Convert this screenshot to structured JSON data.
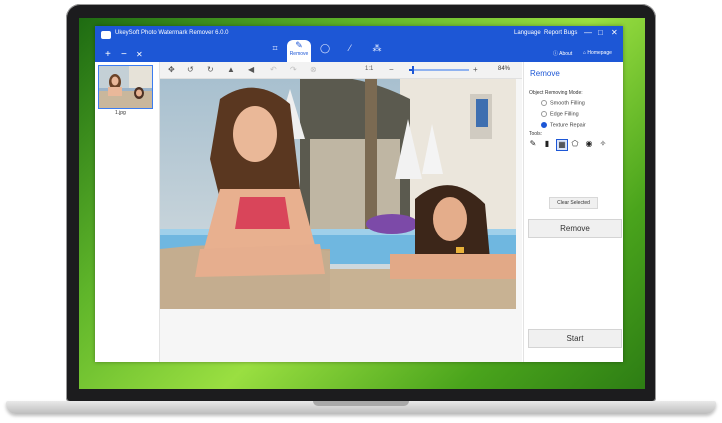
{
  "window": {
    "title": "UkeySoft Photo Watermark Remover 6.0.0",
    "language": "Language",
    "report_bugs": "Report Bugs",
    "about": "About",
    "homepage": "Homepage",
    "minimize": "—",
    "maximize": "□",
    "close": "✕"
  },
  "file_controls": {
    "add": "+",
    "remove": "−",
    "clear": "✕"
  },
  "toolbar": {
    "tabs": [
      {
        "icon": "crop-icon",
        "glyph": "⌗",
        "label": ""
      },
      {
        "icon": "eraser-icon",
        "glyph": "✎",
        "label": "Remove"
      },
      {
        "icon": "drop-icon",
        "glyph": "◯",
        "label": ""
      },
      {
        "icon": "brush-icon",
        "glyph": "⁄",
        "label": ""
      },
      {
        "icon": "key-icon",
        "glyph": "⁂",
        "label": ""
      }
    ]
  },
  "thumbnails": [
    {
      "filename": "1.jpg"
    }
  ],
  "canvas_toolbar": {
    "icons": [
      "move-icon",
      "rotate-left-icon",
      "rotate-right-icon",
      "flip-icon",
      "flip-vertical-icon",
      "undo-icon",
      "redo-icon",
      "reset-icon"
    ],
    "ratio": "1:1",
    "zoom_minus": "−",
    "zoom_plus": "+",
    "zoom_fraction": 0.05,
    "zoom_percent": "84%"
  },
  "right_panel": {
    "title": "Remove",
    "mode_label": "Object Removing Mode:",
    "modes": [
      {
        "label": "Smooth Filling",
        "selected": false
      },
      {
        "label": "Edge Filling",
        "selected": false
      },
      {
        "label": "Texture Repair",
        "selected": true
      }
    ],
    "tools_label": "Tools:",
    "tools": [
      "brush-icon",
      "eraser-icon",
      "rectangle-select-icon",
      "polygon-select-icon",
      "fill-bucket-icon",
      "magic-wand-icon"
    ],
    "clear_selected": "Clear Selected",
    "remove_button": "Remove",
    "start_button": "Start"
  },
  "colors": {
    "accent": "#1d57d6",
    "desktop_green": "#5fb52a"
  }
}
